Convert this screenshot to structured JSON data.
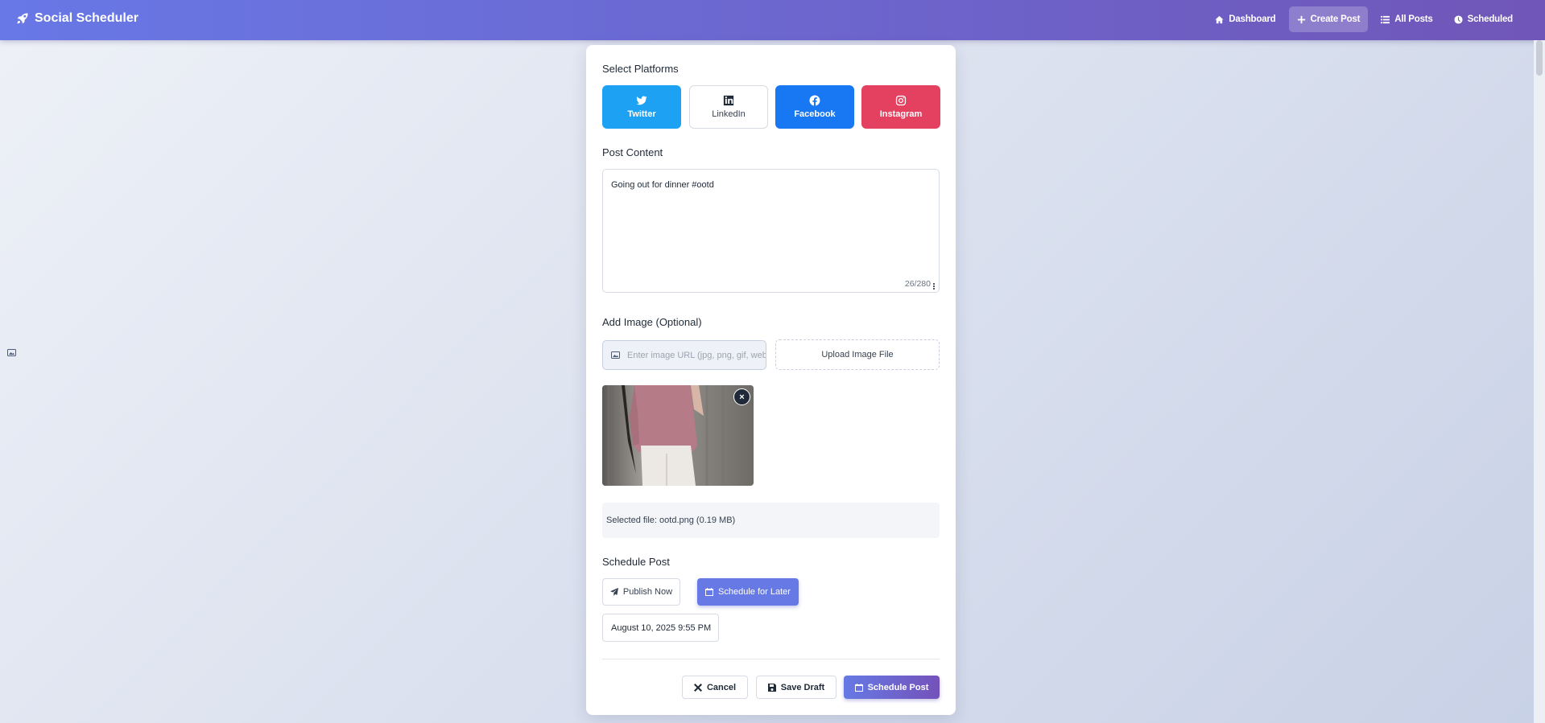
{
  "app": {
    "title": "Social Scheduler"
  },
  "nav": [
    {
      "label": "Dashboard",
      "icon": "home-icon"
    },
    {
      "label": "Create Post",
      "icon": "plus-icon",
      "active": true
    },
    {
      "label": "All Posts",
      "icon": "list-icon"
    },
    {
      "label": "Scheduled",
      "icon": "clock-icon"
    }
  ],
  "platforms": {
    "label": "Select Platforms",
    "items": [
      {
        "label": "Twitter",
        "icon": "twitter-icon",
        "selected": true,
        "color": "#1da1f2"
      },
      {
        "label": "LinkedIn",
        "icon": "linkedin-icon",
        "selected": false,
        "color": "#ffffff"
      },
      {
        "label": "Facebook",
        "icon": "facebook-icon",
        "selected": true,
        "color": "#1877f2"
      },
      {
        "label": "Instagram",
        "icon": "instagram-icon",
        "selected": true,
        "color": "#e4405f"
      }
    ]
  },
  "content": {
    "label": "Post Content",
    "value": "Going out for dinner #ootd",
    "counter": "26/280"
  },
  "image": {
    "label": "Add Image (Optional)",
    "url_placeholder": "Enter image URL (jpg, png, gif, webp)",
    "upload_label": "Upload Image File",
    "remove_label": "×",
    "file_info": "Selected file: ootd.png (0.19 MB)"
  },
  "schedule": {
    "label": "Schedule Post",
    "publish_now": "Publish Now",
    "schedule_later": "Schedule for Later",
    "selected_mode": "later",
    "datetime": "August 10, 2025 9:55 PM"
  },
  "actions": {
    "cancel": "Cancel",
    "save_draft": "Save Draft",
    "schedule_post": "Schedule Post"
  },
  "colors": {
    "accent": "#6679e4",
    "header_start": "#6878e6",
    "header_end": "#7056b8"
  }
}
